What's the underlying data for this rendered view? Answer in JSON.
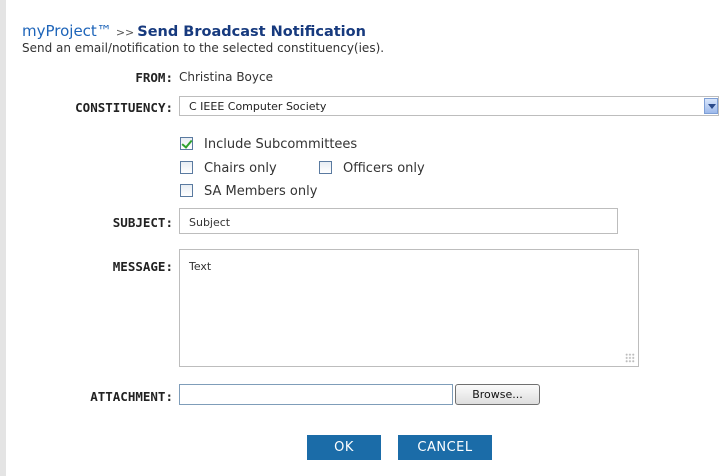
{
  "header": {
    "brand": "myProject™",
    "separator": ">>",
    "title": "Send Broadcast Notification",
    "subtitle": "Send an email/notification to the selected constituency(ies)."
  },
  "form": {
    "from": {
      "label": "FROM:",
      "value": "Christina Boyce"
    },
    "constituency": {
      "label": "CONSTITUENCY:",
      "selected": "C IEEE Computer Society"
    },
    "options": {
      "include_subcommittees": {
        "label": "Include Subcommittees",
        "checked": true
      },
      "chairs_only": {
        "label": "Chairs only",
        "checked": false
      },
      "officers_only": {
        "label": "Officers only",
        "checked": false
      },
      "sa_members_only": {
        "label": "SA Members only",
        "checked": false
      }
    },
    "subject": {
      "label": "SUBJECT:",
      "value": "Subject"
    },
    "message": {
      "label": "MESSAGE:",
      "value": "Text"
    },
    "attachment": {
      "label": "ATTACHMENT:",
      "value": "",
      "browse_label": "Browse..."
    }
  },
  "actions": {
    "ok_label": "OK",
    "cancel_label": "CANCEL"
  },
  "colors": {
    "brand": "#1d64b9",
    "title": "#173a7e",
    "button": "#1b6ca8",
    "check": "#2ea22e"
  }
}
